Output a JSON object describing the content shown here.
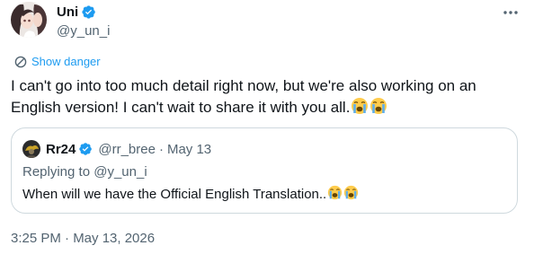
{
  "author": {
    "display_name": "Uni",
    "handle": "@y_un_i",
    "avatar_icon": "anime-avatar-icon",
    "verified_color": "#1d9bf0"
  },
  "translate": {
    "label": "Show danger",
    "icon": "translate-icon"
  },
  "tweet": {
    "text": "I can't go into too much detail right now, but we're also working on an English version! I can't wait to share it with you all.",
    "emoji": [
      "loudly-crying-face",
      "loudly-crying-face"
    ],
    "timestamp": "3:25 PM · May 13, 2026"
  },
  "quote": {
    "display_name": "Rr24",
    "handle": "@rr_bree",
    "separator": "·",
    "date": "May 13",
    "replying_prefix": "Replying to ",
    "replying_to": "@y_un_i",
    "text": "When will we have the Official English Translation..",
    "emoji": [
      "loudly-crying-face",
      "loudly-crying-face"
    ]
  },
  "colors": {
    "accent": "#1d9bf0",
    "text_primary": "#0f1419",
    "text_secondary": "#536471",
    "border": "#cfd9de"
  }
}
